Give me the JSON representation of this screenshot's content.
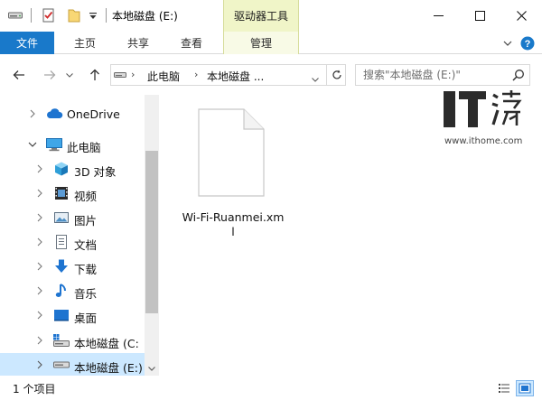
{
  "window": {
    "title": "本地磁盘 (E:)",
    "context_tab": "驱动器工具"
  },
  "ribbon": {
    "tabs": [
      "文件",
      "主页",
      "共享",
      "查看",
      "管理"
    ],
    "active_tab": "文件"
  },
  "address_bar": {
    "segments": [
      "此电脑",
      "本地磁盘 ..."
    ]
  },
  "search": {
    "placeholder": "搜索\"本地磁盘 (E:)\""
  },
  "nav_pane": {
    "items": [
      {
        "label": "OneDrive",
        "icon": "cloud-icon",
        "expanded": false
      },
      {
        "label": "此电脑",
        "icon": "computer-icon",
        "expanded": true
      },
      {
        "label": "3D 对象",
        "icon": "cube-icon",
        "expanded": false
      },
      {
        "label": "视频",
        "icon": "video-icon",
        "expanded": false
      },
      {
        "label": "图片",
        "icon": "pictures-icon",
        "expanded": false
      },
      {
        "label": "文档",
        "icon": "document-icon",
        "expanded": false
      },
      {
        "label": "下载",
        "icon": "download-icon",
        "expanded": false
      },
      {
        "label": "音乐",
        "icon": "music-icon",
        "expanded": false
      },
      {
        "label": "桌面",
        "icon": "desktop-icon",
        "expanded": false
      },
      {
        "label": "本地磁盘 (C:",
        "icon": "system-drive-icon",
        "expanded": false
      },
      {
        "label": "本地磁盘 (E:)",
        "icon": "drive-icon",
        "expanded": false,
        "selected": true
      }
    ]
  },
  "content": {
    "files": [
      {
        "name": "Wi-Fi-Ruanmei.xml",
        "icon": "xml-file-icon"
      }
    ]
  },
  "watermark": {
    "site": "www.ithome.com"
  },
  "status": {
    "item_count": "1 个项目"
  },
  "colors": {
    "accent": "#1979ca",
    "selection": "#cce8ff",
    "context_tab": "#f0f5c8"
  }
}
